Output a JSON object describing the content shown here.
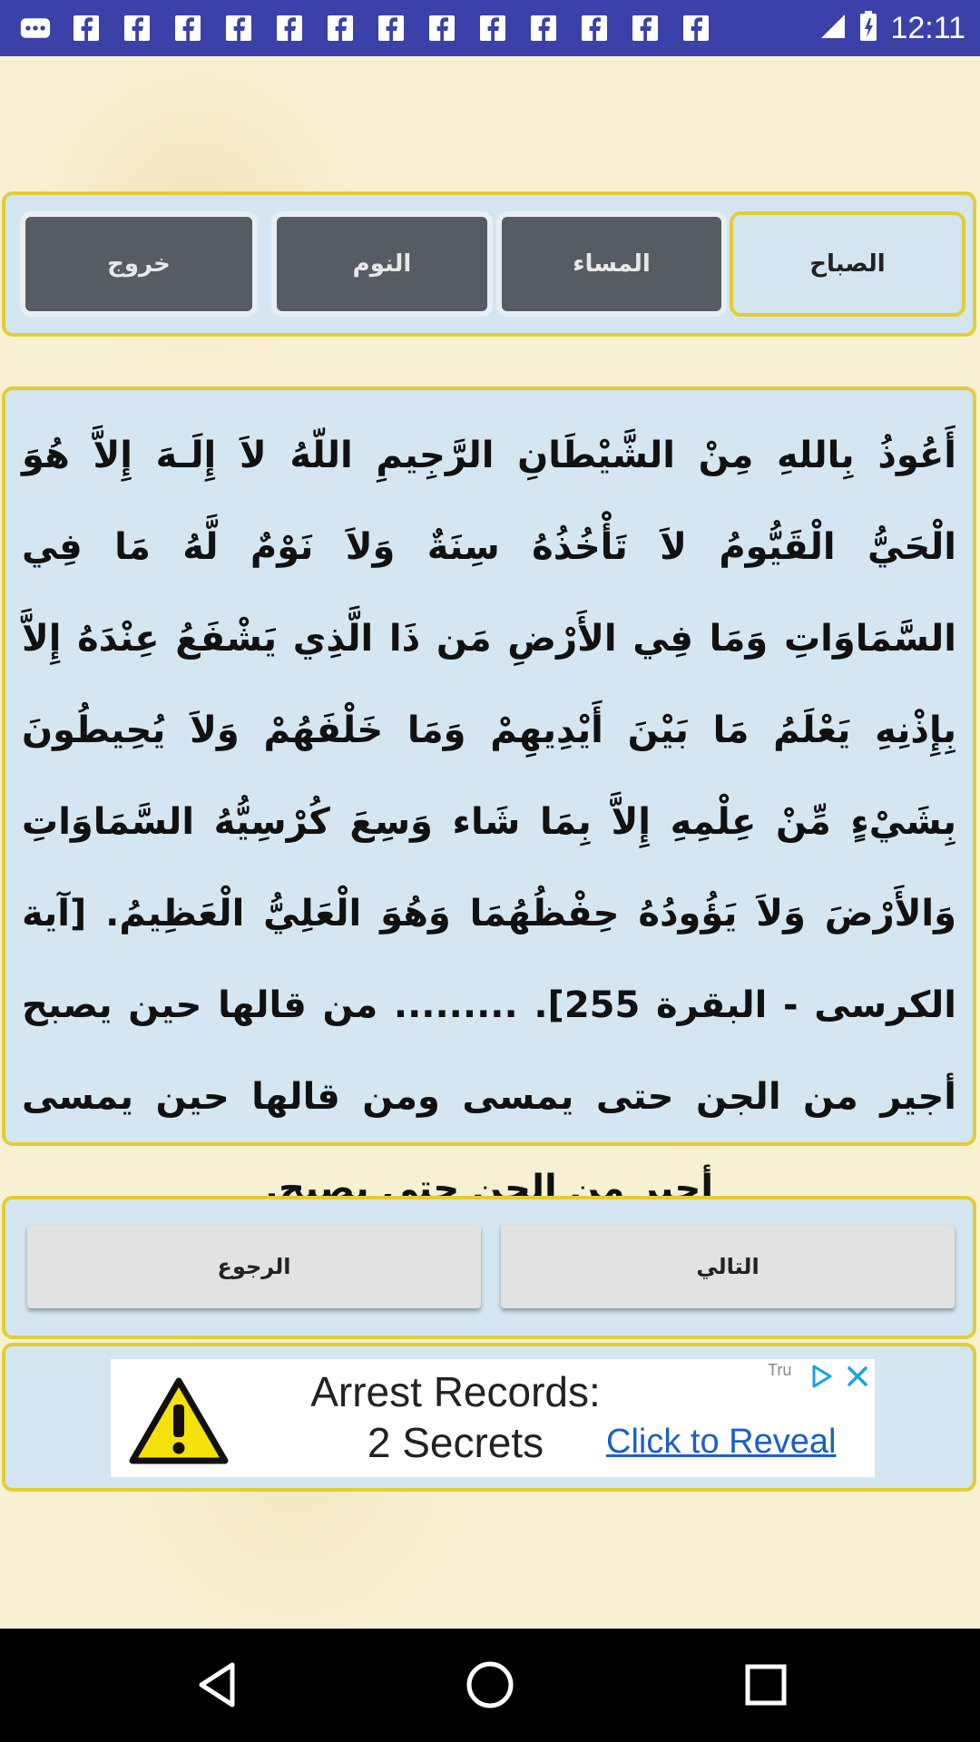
{
  "status_bar": {
    "time": "12:11",
    "icons": [
      "more-notifications-icon",
      "facebook-icon",
      "facebook-icon",
      "facebook-icon",
      "facebook-icon",
      "facebook-icon",
      "facebook-icon",
      "facebook-icon",
      "facebook-icon",
      "facebook-icon",
      "facebook-icon",
      "facebook-icon",
      "facebook-icon",
      "signal-icon",
      "battery-icon"
    ]
  },
  "tabs": {
    "morning": "الصباح",
    "evening": "المساء",
    "sleep": "النوم",
    "exit": "خروج"
  },
  "content": {
    "ayah_text": "أَعُوذُ بِاللهِ مِنْ الشَّيْطَانِ الرَّجِيمِ اللّهُ لاَ إِلَـهَ إِلاَّ هُوَ الْحَيُّ الْقَيُّومُ لاَ تَأْخُذُهُ سِنَةٌ وَلاَ نَوْمٌ لَّهُ مَا فِي السَّمَاوَاتِ وَمَا فِي الأَرْضِ مَن ذَا الَّذِي يَشْفَعُ عِنْدَهُ إِلاَّ بِإِذْنِهِ يَعْلَمُ مَا بَيْنَ أَيْدِيهِمْ وَمَا خَلْفَهُمْ وَلاَ يُحِيطُونَ بِشَيْءٍ مِّنْ عِلْمِهِ إِلاَّ بِمَا شَاء وَسِعَ كُرْسِيُّهُ السَّمَاوَاتِ وَالأَرْضَ وَلاَ يَؤُودُهُ حِفْظُهُمَا وَهُوَ الْعَلِيُّ الْعَظِيمُ. [آية الكرسى - البقرة 255]. ......... من قالها حين يصبح أجير من الجن حتى يمسى ومن قالها حين يمسى أجير من الجن حتى يصبح."
  },
  "navigation": {
    "next": "التالي",
    "back": "الرجوع"
  },
  "ad": {
    "headline_line1": "Arrest Records:",
    "headline_line2": "2 Secrets",
    "cta": "Click to Reveal",
    "tag": "Tru"
  },
  "colors": {
    "status_bar": "#3a41a8",
    "panel_border": "#e4cd34",
    "panel_fill": "#d4e6f2",
    "tab_dark": "#555c63",
    "page_background": "#f8f0d2"
  }
}
